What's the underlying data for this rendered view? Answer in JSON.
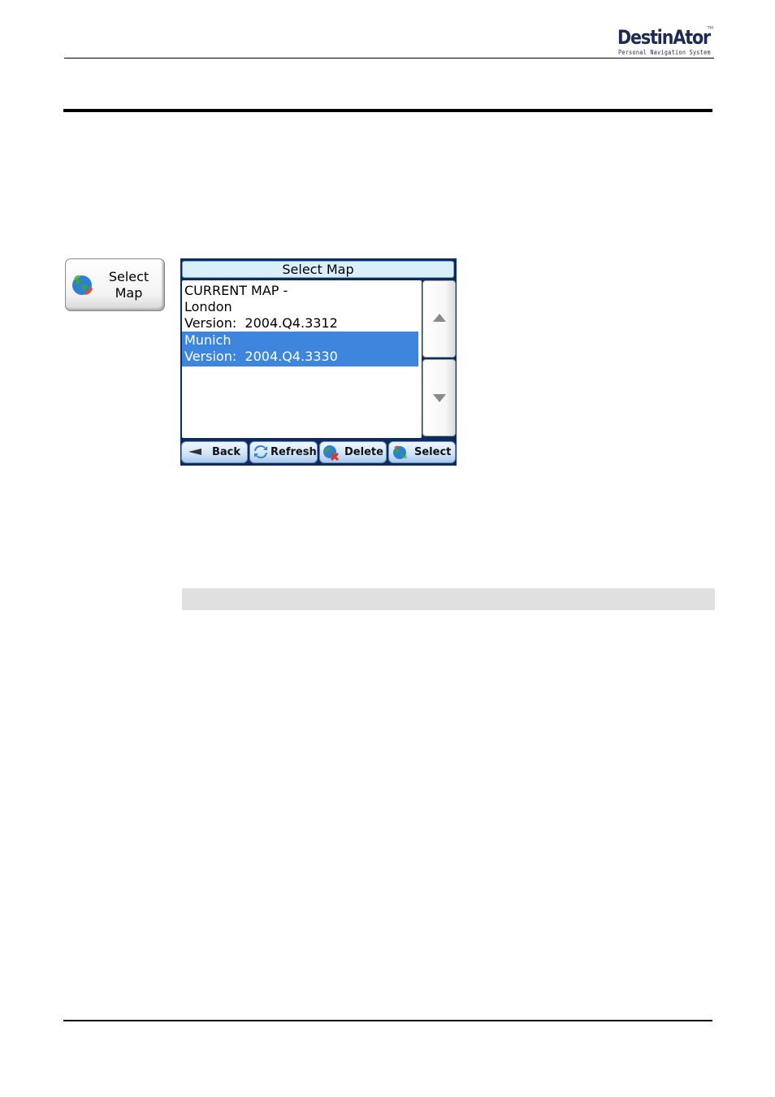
{
  "header": {
    "logo_main": "DestinAtor",
    "logo_tm": "TM",
    "logo_subtitle": "Personal Navigation System"
  },
  "select_map_button": {
    "label_line1": "Select",
    "label_line2": "Map",
    "icon": "globe-refresh-icon"
  },
  "screen": {
    "title": "Select Map",
    "items": [
      {
        "lines": [
          "CURRENT MAP -",
          "London",
          "Version:  2004.Q4.3312"
        ],
        "selected": false
      },
      {
        "lines": [
          "Munich",
          "Version:  2004.Q4.3330"
        ],
        "selected": true
      }
    ],
    "scroll_up_icon": "triangle-up-icon",
    "scroll_down_icon": "triangle-down-icon",
    "toolbar": {
      "back": "Back",
      "refresh": "Refresh",
      "delete": "Delete",
      "select": "Select"
    },
    "colors": {
      "selected_row": "#3d85dd",
      "frame": "#0f2a5e",
      "title_bar": "#d9f0fb"
    }
  }
}
